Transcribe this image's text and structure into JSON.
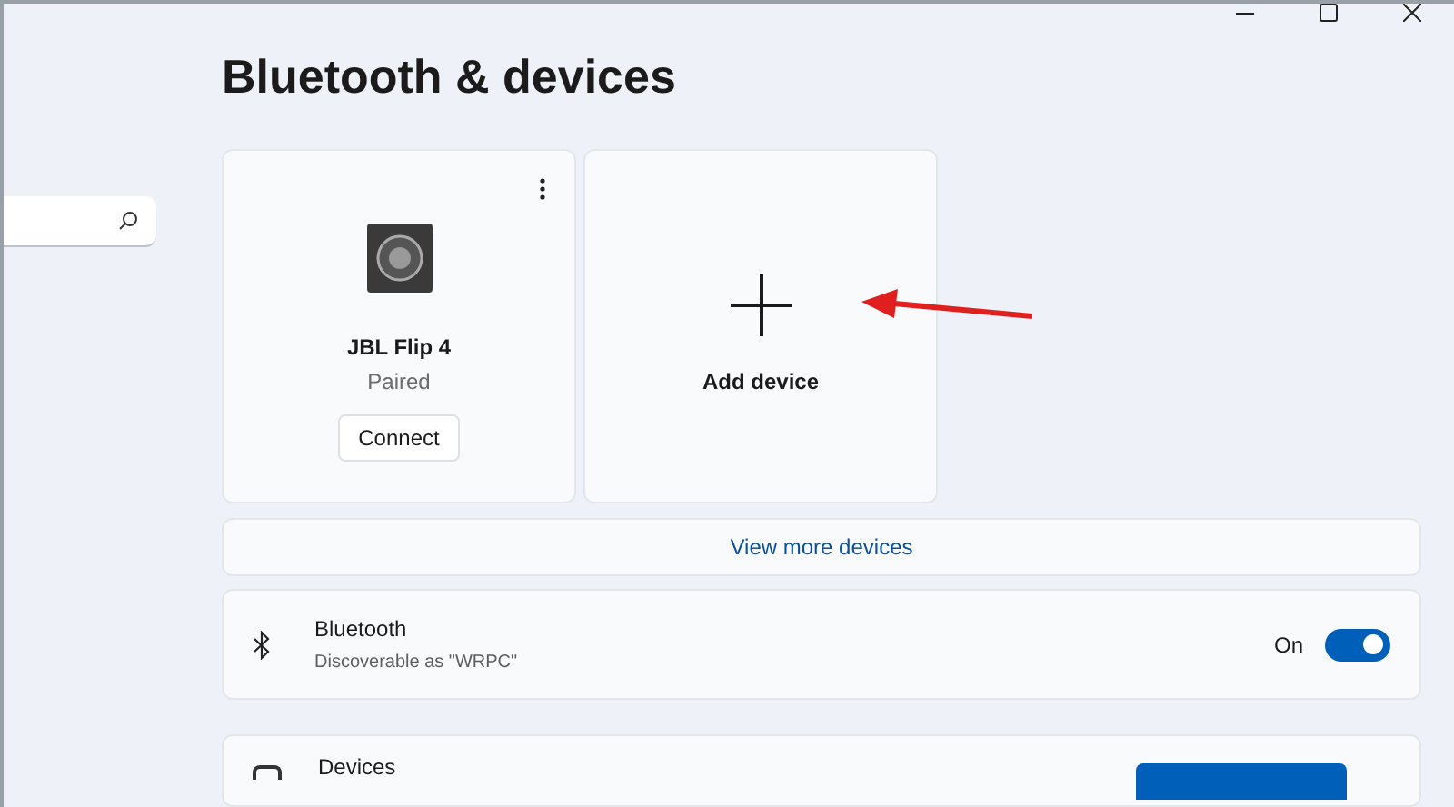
{
  "page": {
    "title": "Bluetooth & devices"
  },
  "devices": [
    {
      "name": "JBL Flip 4",
      "status": "Paired",
      "action": "Connect"
    }
  ],
  "add_device": {
    "label": "Add device"
  },
  "view_more": {
    "label": "View more devices"
  },
  "bluetooth": {
    "title": "Bluetooth",
    "subtitle": "Discoverable as \"WRPC\"",
    "state_label": "On",
    "on": true
  },
  "devices_row": {
    "title": "Devices"
  }
}
